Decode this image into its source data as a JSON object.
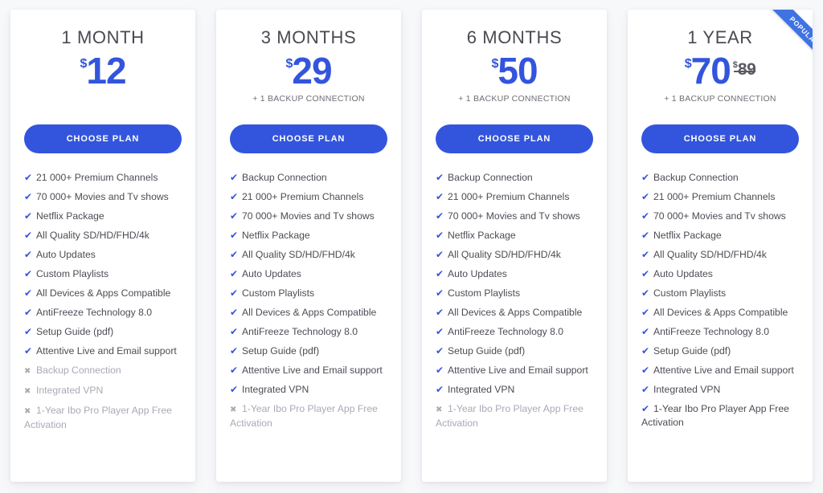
{
  "theme": {
    "accent_blue": "#3355dd",
    "ribbon_blue": "#3f73e3",
    "page_background": "#f7f8fa",
    "title_gray": "#4a4a52",
    "disabled_gray": "#a9aab6"
  },
  "plans": [
    {
      "title": "1 MONTH",
      "currency": "$",
      "price": "12",
      "old_currency": "",
      "old_price": "",
      "subtitle": "",
      "button_label": "CHOOSE PLAN",
      "popular": false,
      "ribbon_label": "",
      "features": [
        {
          "label": "21 000+ Premium Channels",
          "included": true,
          "mark": "check-icon"
        },
        {
          "label": "70 000+ Movies and Tv shows",
          "included": true,
          "mark": "check-icon"
        },
        {
          "label": "Netflix Package",
          "included": true,
          "mark": "check-icon"
        },
        {
          "label": "All Quality SD/HD/FHD/4k",
          "included": true,
          "mark": "check-icon"
        },
        {
          "label": "Auto Updates",
          "included": true,
          "mark": "check-icon"
        },
        {
          "label": "Custom Playlists",
          "included": true,
          "mark": "check-icon"
        },
        {
          "label": "All Devices & Apps Compatible",
          "included": true,
          "mark": "check-icon"
        },
        {
          "label": "AntiFreeze Technology 8.0",
          "included": true,
          "mark": "check-icon"
        },
        {
          "label": "Setup Guide (pdf)",
          "included": true,
          "mark": "check-icon"
        },
        {
          "label": "Attentive Live and Email support",
          "included": true,
          "mark": "check-icon"
        },
        {
          "label": "Backup Connection",
          "included": false,
          "mark": "cross-icon"
        },
        {
          "label": "Integrated VPN",
          "included": false,
          "mark": "cross-icon"
        },
        {
          "label": "1-Year Ibo Pro Player App Free Activation",
          "included": false,
          "mark": "cross-icon"
        }
      ]
    },
    {
      "title": "3 MONTHS",
      "currency": "$",
      "price": "29",
      "old_currency": "",
      "old_price": "",
      "subtitle": "+ 1 BACKUP CONNECTION",
      "button_label": "CHOOSE PLAN",
      "popular": false,
      "ribbon_label": "",
      "features": [
        {
          "label": "Backup Connection",
          "included": true,
          "mark": "check-icon"
        },
        {
          "label": "21 000+ Premium Channels",
          "included": true,
          "mark": "check-icon"
        },
        {
          "label": "70 000+ Movies and Tv shows",
          "included": true,
          "mark": "check-icon"
        },
        {
          "label": "Netflix Package",
          "included": true,
          "mark": "check-icon"
        },
        {
          "label": "All Quality SD/HD/FHD/4k",
          "included": true,
          "mark": "check-icon"
        },
        {
          "label": "Auto Updates",
          "included": true,
          "mark": "check-icon"
        },
        {
          "label": "Custom Playlists",
          "included": true,
          "mark": "check-icon"
        },
        {
          "label": "All Devices & Apps Compatible",
          "included": true,
          "mark": "check-icon"
        },
        {
          "label": "AntiFreeze Technology 8.0",
          "included": true,
          "mark": "check-icon"
        },
        {
          "label": "Setup Guide (pdf)",
          "included": true,
          "mark": "check-icon"
        },
        {
          "label": "Attentive Live and Email support",
          "included": true,
          "mark": "check-icon"
        },
        {
          "label": "Integrated VPN",
          "included": true,
          "mark": "check-icon"
        },
        {
          "label": "1-Year Ibo Pro Player App Free Activation",
          "included": false,
          "mark": "cross-icon"
        }
      ]
    },
    {
      "title": "6 MONTHS",
      "currency": "$",
      "price": "50",
      "old_currency": "",
      "old_price": "",
      "subtitle": "+ 1 BACKUP CONNECTION",
      "button_label": "CHOOSE PLAN",
      "popular": false,
      "ribbon_label": "",
      "features": [
        {
          "label": "Backup Connection",
          "included": true,
          "mark": "check-icon"
        },
        {
          "label": "21 000+ Premium Channels",
          "included": true,
          "mark": "check-icon"
        },
        {
          "label": "70 000+ Movies and Tv shows",
          "included": true,
          "mark": "check-icon"
        },
        {
          "label": "Netflix Package",
          "included": true,
          "mark": "check-icon"
        },
        {
          "label": "All Quality SD/HD/FHD/4k",
          "included": true,
          "mark": "check-icon"
        },
        {
          "label": "Auto Updates",
          "included": true,
          "mark": "check-icon"
        },
        {
          "label": "Custom Playlists",
          "included": true,
          "mark": "check-icon"
        },
        {
          "label": "All Devices & Apps Compatible",
          "included": true,
          "mark": "check-icon"
        },
        {
          "label": "AntiFreeze Technology 8.0",
          "included": true,
          "mark": "check-icon"
        },
        {
          "label": "Setup Guide (pdf)",
          "included": true,
          "mark": "check-icon"
        },
        {
          "label": "Attentive Live and Email support",
          "included": true,
          "mark": "check-icon"
        },
        {
          "label": "Integrated VPN",
          "included": true,
          "mark": "check-icon"
        },
        {
          "label": "1-Year Ibo Pro Player App Free Activation",
          "included": false,
          "mark": "cross-icon"
        }
      ]
    },
    {
      "title": "1 YEAR",
      "currency": "$",
      "price": "70",
      "old_currency": "$",
      "old_price": "89",
      "subtitle": "+ 1 BACKUP CONNECTION",
      "button_label": "CHOOSE PLAN",
      "popular": true,
      "ribbon_label": "POPULAR",
      "features": [
        {
          "label": "Backup Connection",
          "included": true,
          "mark": "check-icon"
        },
        {
          "label": "21 000+ Premium Channels",
          "included": true,
          "mark": "check-icon"
        },
        {
          "label": "70 000+ Movies and Tv shows",
          "included": true,
          "mark": "check-icon"
        },
        {
          "label": "Netflix Package",
          "included": true,
          "mark": "check-icon"
        },
        {
          "label": "All Quality SD/HD/FHD/4k",
          "included": true,
          "mark": "check-icon"
        },
        {
          "label": "Auto Updates",
          "included": true,
          "mark": "check-icon"
        },
        {
          "label": "Custom Playlists",
          "included": true,
          "mark": "check-icon"
        },
        {
          "label": "All Devices & Apps Compatible",
          "included": true,
          "mark": "check-icon"
        },
        {
          "label": "AntiFreeze Technology 8.0",
          "included": true,
          "mark": "check-icon"
        },
        {
          "label": "Setup Guide (pdf)",
          "included": true,
          "mark": "check-icon"
        },
        {
          "label": "Attentive Live and Email support",
          "included": true,
          "mark": "check-icon"
        },
        {
          "label": "Integrated VPN",
          "included": true,
          "mark": "check-icon"
        },
        {
          "label": "1-Year Ibo Pro Player App Free Activation",
          "included": true,
          "mark": "check-icon"
        }
      ]
    }
  ],
  "glyphs": {
    "check-icon": "✔",
    "cross-icon": "✖"
  }
}
